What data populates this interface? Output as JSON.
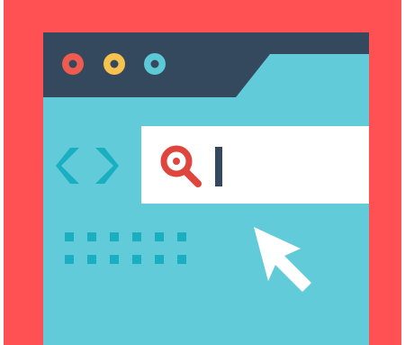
{
  "illustration": {
    "name": "browser-search-illustration",
    "colors": {
      "background": "#FFFFFF",
      "frame": "#FF5054",
      "titlebar": "#34495E",
      "content": "#62CBD9",
      "searchbar": "#FFFFFF",
      "search_icon": "#E0453D",
      "cursor_caret": "#34495E",
      "dot_red": "#EF5B4F",
      "dot_yellow": "#F7C24D",
      "dot_teal": "#5CC9D6",
      "dot_ring": "#34495E",
      "code_brackets": "#1AAFC0",
      "grid_squares": "#1AAFC0",
      "pointer": "#FFFFFF"
    },
    "icons": {
      "window_dots": [
        "red-dot-icon",
        "yellow-dot-icon",
        "teal-dot-icon"
      ],
      "code": "code-brackets-icon",
      "search": "magnifier-icon",
      "caret": "text-cursor-icon",
      "pointer": "mouse-pointer-icon"
    },
    "grid": {
      "rows": 2,
      "cols": 6
    }
  }
}
